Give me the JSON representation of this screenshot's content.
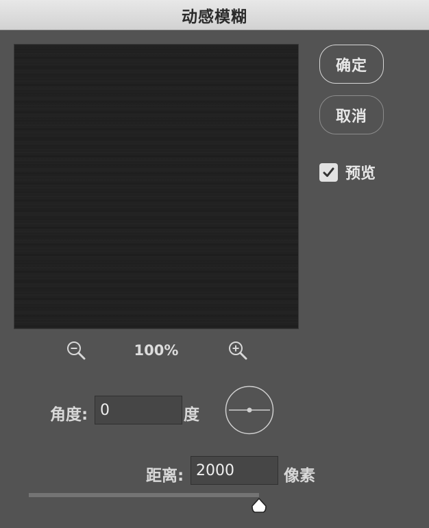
{
  "window": {
    "title": "动感模糊"
  },
  "buttons": {
    "ok_label": "确定",
    "cancel_label": "取消"
  },
  "preview_toggle": {
    "label": "预览",
    "checked": true
  },
  "zoom": {
    "level": "100%"
  },
  "angle": {
    "label": "角度:",
    "value": "0",
    "unit": "度"
  },
  "distance": {
    "label": "距离:",
    "value": "2000",
    "unit": "像素"
  },
  "icons": {
    "zoom_out": "zoom-out-icon",
    "zoom_in": "zoom-in-icon",
    "check": "checkmark-icon",
    "dial": "angle-dial-icon",
    "thumb": "slider-thumb-icon"
  }
}
